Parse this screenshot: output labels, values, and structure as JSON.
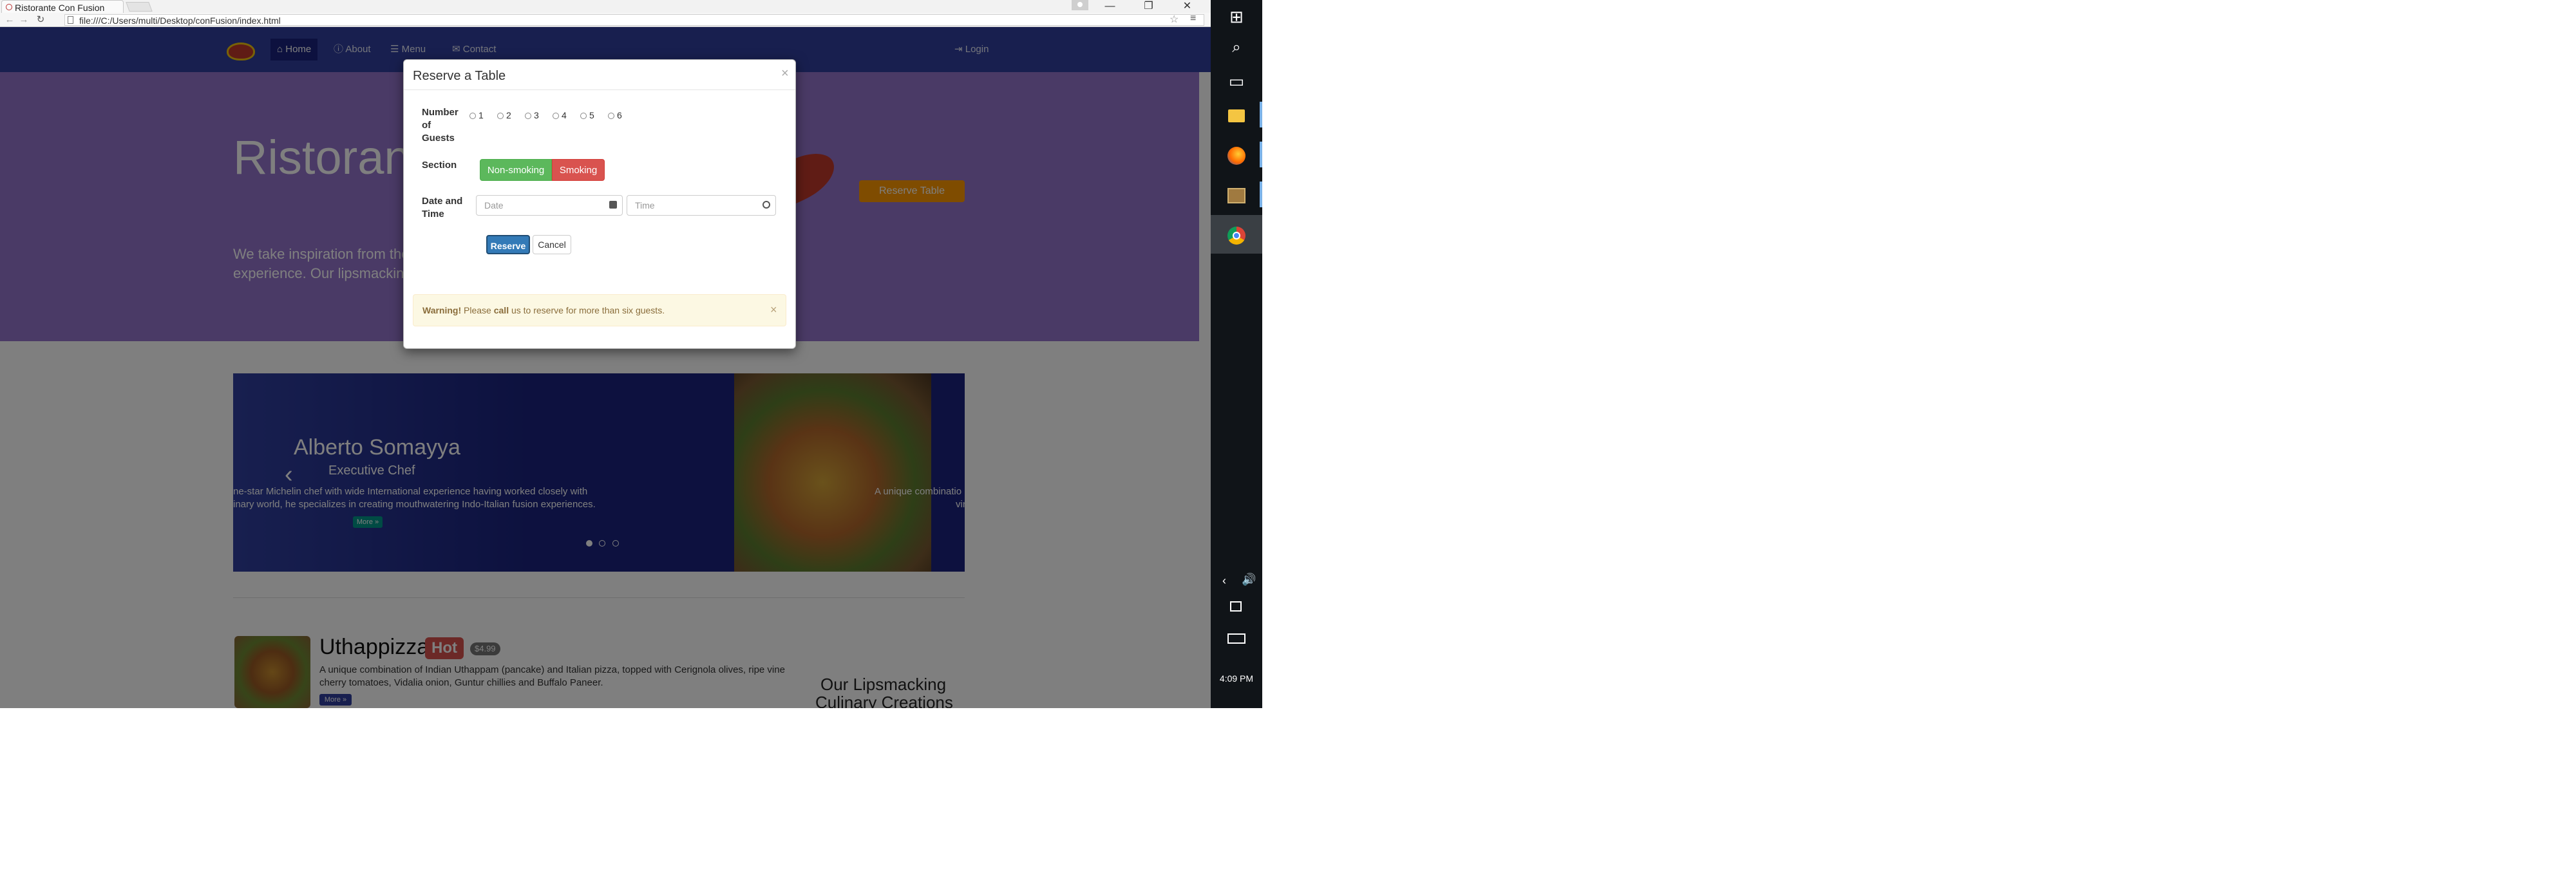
{
  "browser": {
    "tab_title": "Ristorante Con Fusion",
    "url": "file:///C:/Users/multi/Desktop/conFusion/index.html",
    "window_controls": {
      "minimize": "—",
      "maximize": "❐",
      "close": "✕"
    }
  },
  "navbar": {
    "items": [
      {
        "label": "Home",
        "icon": "home-icon",
        "active": true
      },
      {
        "label": "About",
        "icon": "info-icon"
      },
      {
        "label": "Menu",
        "icon": "list-icon"
      },
      {
        "label": "Contact",
        "icon": "envelope-icon"
      }
    ],
    "login_label": "Login"
  },
  "jumbotron": {
    "title": "Ristorante",
    "desc_line1": "We take inspiration from the",
    "desc_line2": "experience. Our lipsmackin",
    "reserve_button": "Reserve Table"
  },
  "carousel": {
    "slide_name": "Alberto Somayya",
    "slide_role": "Executive Chef",
    "slide_desc_line1": "ne-star Michelin chef with wide International experience having worked closely with",
    "slide_desc_line2": "inary world, he specializes in creating mouthwatering Indo-Italian fusion experiences.",
    "more_label": "More »",
    "next_desc_line1": "A unique combinatio",
    "next_desc_line2": "vin",
    "indicator_count": 3,
    "active_indicator": 1
  },
  "dish": {
    "title": "Uthappizza",
    "badge": "Hot",
    "price": "$4.99",
    "desc_line1": "A unique combination of Indian Uthappam (pancake) and Italian pizza, topped with Cerignola olives, ripe vine",
    "desc_line2": "cherry tomatoes, Vidalia onion, Guntur chillies and Buffalo Paneer.",
    "more_label": "More »"
  },
  "side": {
    "heading_line1": "Our Lipsmacking",
    "heading_line2": "Culinary Creations"
  },
  "modal": {
    "title": "Reserve a Table",
    "close": "×",
    "guests_label": "Number of Guests",
    "guest_options": [
      "1",
      "2",
      "3",
      "4",
      "5",
      "6"
    ],
    "section_label": "Section",
    "section_options": [
      "Non-smoking",
      "Smoking"
    ],
    "datetime_label": "Date and Time",
    "date_placeholder": "Date",
    "time_placeholder": "Time",
    "reserve_button": "Reserve",
    "cancel_button": "Cancel",
    "alert": {
      "strong": "Warning!",
      "text_before": " Please ",
      "bold_word": "call",
      "text_after": " us to reserve for more than six guests.",
      "close": "×"
    }
  },
  "taskbar": {
    "time": "4:09 PM"
  },
  "colors": {
    "navbar": "#303F9F",
    "jumbotron": "#9575CD",
    "reserve_button": "#FF9800",
    "nonsmoking": "#5cb85c",
    "smoking": "#d9534f",
    "primary": "#337ab7",
    "alert_bg": "#fcf8e3"
  }
}
